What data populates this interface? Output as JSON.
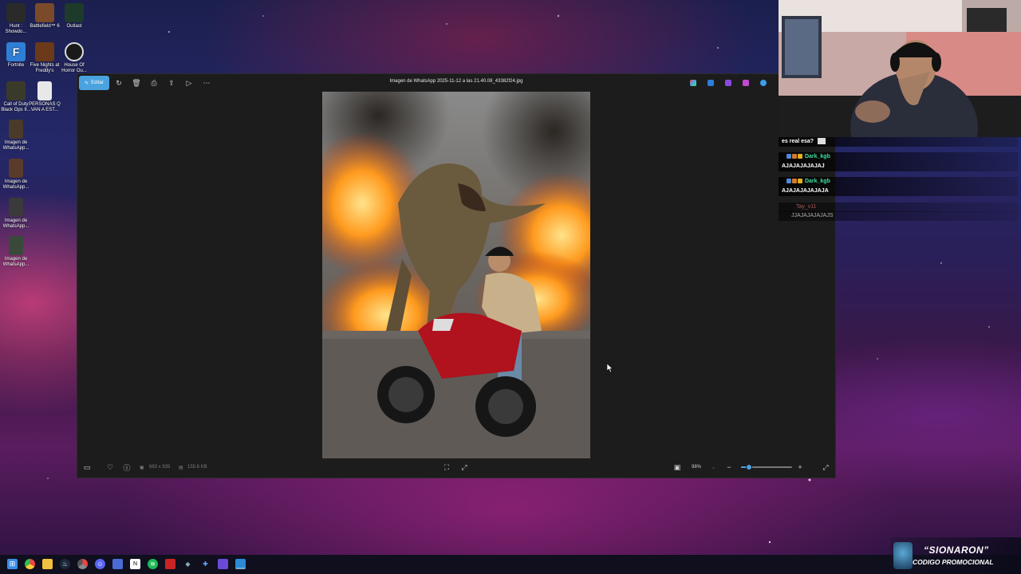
{
  "desktop": {
    "icons": [
      {
        "label": "Hunt : Showdo...",
        "icon": "hunt-icon",
        "color": "#2a2a2a"
      },
      {
        "label": "Battlefield™ 6",
        "icon": "battlefield-icon",
        "color": "#7a4a2a"
      },
      {
        "label": "Outlast",
        "icon": "outlast-icon",
        "color": "#1e3a2a"
      },
      {
        "label": "Fortnite",
        "icon": "fortnite-icon",
        "color": "#2f7fd6"
      },
      {
        "label": "Five Nights at Freddy's",
        "icon": "fnaf-icon",
        "color": "#6a3a1a"
      },
      {
        "label": "House Of Horror Ou...",
        "icon": "house-of-horror-icon",
        "color": "#1a1a1a"
      },
      {
        "label": "Call of Duty Black Ops II...",
        "icon": "cod-icon",
        "color": "#3a3a2a"
      },
      {
        "label": "PERSONAS Q VAN A EST...",
        "icon": "text-file-icon",
        "color": "#e8e8e8"
      },
      {
        "label": "Imagen de WhatsApp...",
        "icon": "image-file-icon",
        "color": "#4a3a2a"
      },
      {
        "label": "Imagen de WhatsApp...",
        "icon": "image-file-icon",
        "color": "#5a3a2a"
      },
      {
        "label": "Imagen de WhatsApp...",
        "icon": "image-file-icon",
        "color": "#3a3a3a"
      },
      {
        "label": "Imagen de WhatsApp...",
        "icon": "image-file-icon",
        "color": "#3a4a3a"
      }
    ]
  },
  "viewer": {
    "edit_label": "Editar",
    "title": "Imagen de WhatsApp 2025-11-12 a las 21.40.08_43382f24.jpg",
    "dimensions": "683 x 935",
    "file_size": "155.6 KB",
    "zoom": "98%",
    "zoom_level": 0.15
  },
  "chat": {
    "messages": [
      {
        "user": "",
        "text": "es real esa?",
        "emote": true
      },
      {
        "user": "Dark_kgb",
        "text": "AJAJAJAJAJAJ"
      },
      {
        "user": "Dark_kgb",
        "text": "AJAJAJAJAJAJA"
      },
      {
        "user": "Tay_v11",
        "text": "JJAJAJAJAJAJS"
      }
    ]
  },
  "promo": {
    "line1": "“SIONARON”",
    "line2": "CODIGO PROMOCIONAL"
  }
}
